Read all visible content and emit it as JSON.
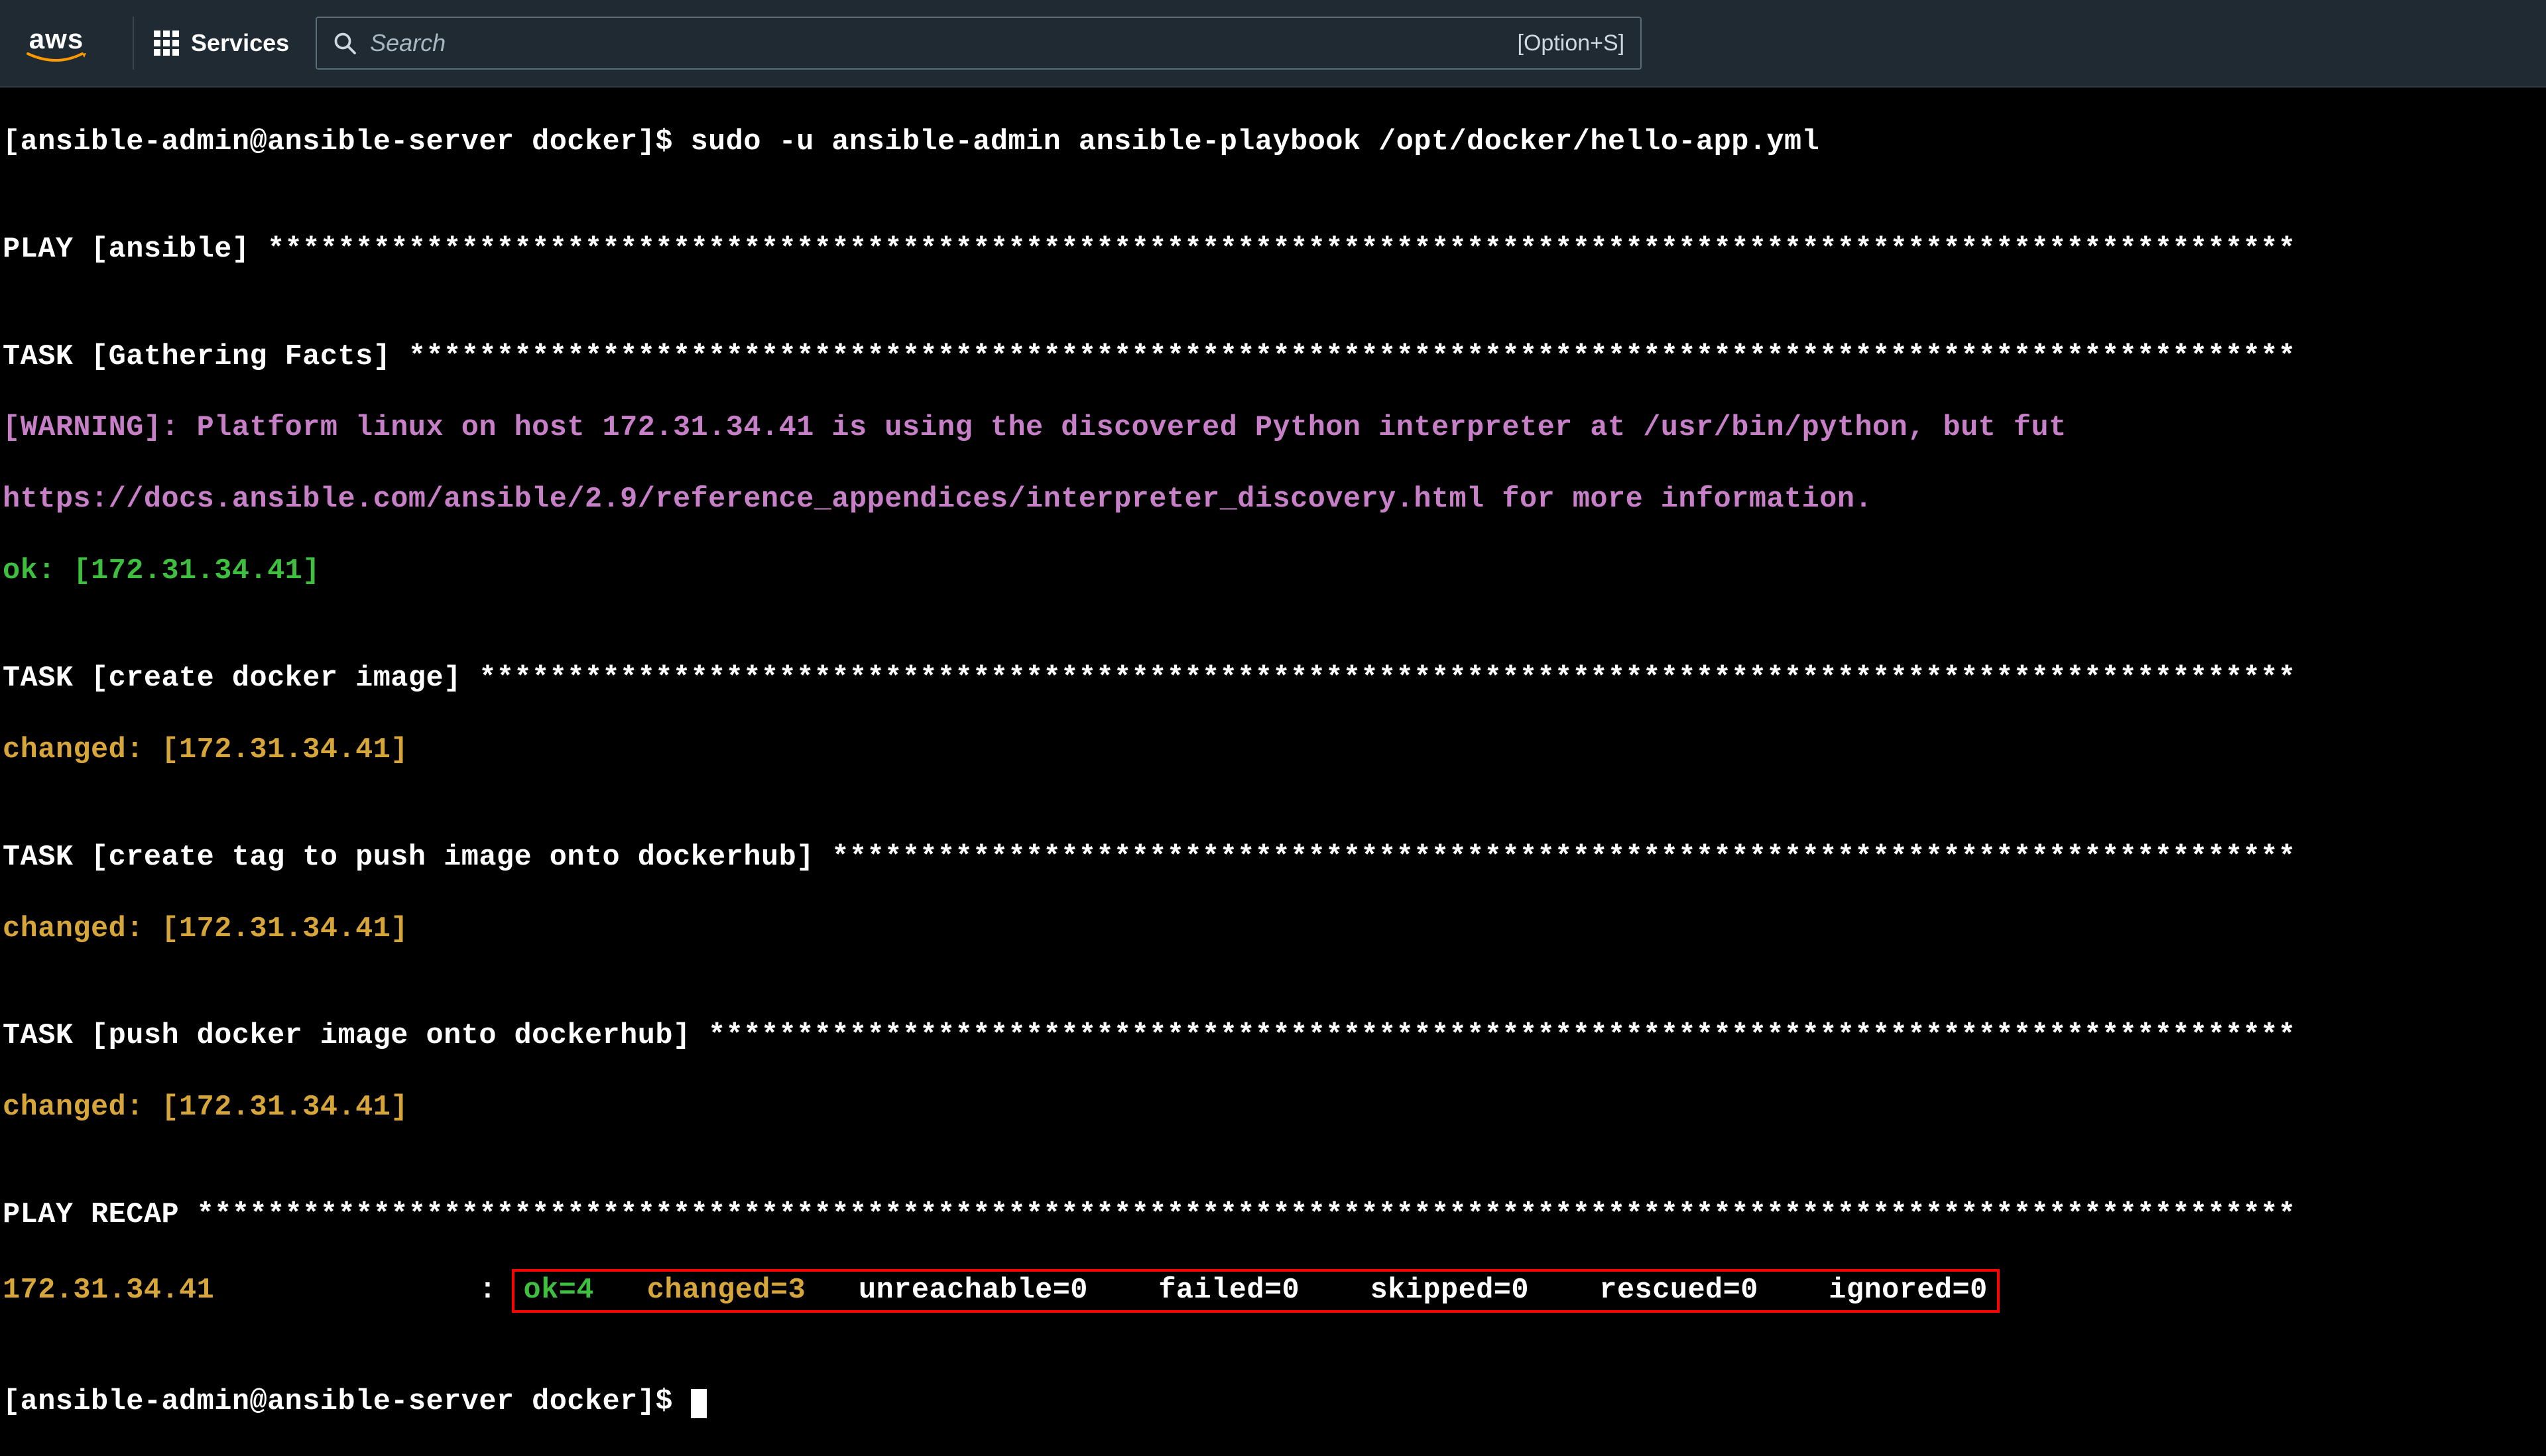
{
  "header": {
    "logo_text": "aws",
    "services_label": "Services",
    "search_placeholder": "Search",
    "search_shortcut": "[Option+S]"
  },
  "term": {
    "prompt_open": "[ansible-admin@ansible-server docker]$ ",
    "command": "sudo -u ansible-admin ansible-playbook /opt/docker/hello-app.yml",
    "blank": "",
    "play_header": "PLAY [ansible] *******************************************************************************************************************",
    "task_gather": "TASK [Gathering Facts] ***********************************************************************************************************",
    "warning": "[WARNING]: Platform linux on host 172.31.34.41 is using the discovered Python interpreter at /usr/bin/python, but fut",
    "warning2": "https://docs.ansible.com/ansible/2.9/reference_appendices/interpreter_discovery.html for more information.",
    "ok_host": "ok: [172.31.34.41]",
    "task_create_img": "TASK [create docker image] *******************************************************************************************************",
    "changed_host": "changed: [172.31.34.41]",
    "task_tag": "TASK [create tag to push image onto dockerhub] ***********************************************************************************",
    "task_push": "TASK [push docker image onto dockerhub] ******************************************************************************************",
    "recap_header": "PLAY RECAP ***********************************************************************************************************************",
    "recap_host": "172.31.34.41               ",
    "recap_colon": ": ",
    "recap_ok": "ok=4   ",
    "recap_changed": "changed=3   ",
    "recap_rest": "unreachable=0    failed=0    skipped=0    rescued=0    ignored=0",
    "prompt_end": "[ansible-admin@ansible-server docker]$ "
  }
}
